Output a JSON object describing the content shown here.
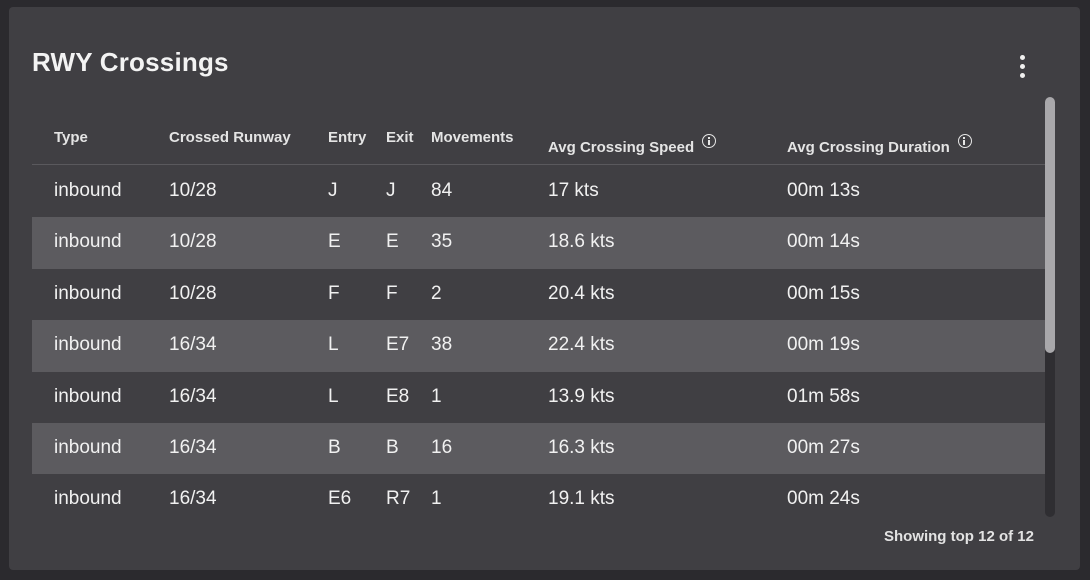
{
  "card": {
    "title": "RWY Crossings",
    "menu_icon": "more-vertical-icon",
    "footer": "Showing top 12 of 12"
  },
  "table": {
    "headers": {
      "type": "Type",
      "runway": "Crossed Runway",
      "entry": "Entry",
      "exit": "Exit",
      "movements": "Movements",
      "speed": "Avg Crossing Speed",
      "duration": "Avg Crossing Duration"
    },
    "info_icon": "info-circle-icon",
    "rows": [
      {
        "type": "inbound",
        "runway": "10/28",
        "entry": "J",
        "exit": "J",
        "movements": "84",
        "speed": "17 kts",
        "duration": "00m 13s"
      },
      {
        "type": "inbound",
        "runway": "10/28",
        "entry": "E",
        "exit": "E",
        "movements": "35",
        "speed": "18.6 kts",
        "duration": "00m 14s"
      },
      {
        "type": "inbound",
        "runway": "10/28",
        "entry": "F",
        "exit": "F",
        "movements": "2",
        "speed": "20.4 kts",
        "duration": "00m 15s"
      },
      {
        "type": "inbound",
        "runway": "16/34",
        "entry": "L",
        "exit": "E7",
        "movements": "38",
        "speed": "22.4 kts",
        "duration": "00m 19s"
      },
      {
        "type": "inbound",
        "runway": "16/34",
        "entry": "L",
        "exit": "E8",
        "movements": "1",
        "speed": "13.9 kts",
        "duration": "01m 58s"
      },
      {
        "type": "inbound",
        "runway": "16/34",
        "entry": "B",
        "exit": "B",
        "movements": "16",
        "speed": "16.3 kts",
        "duration": "00m 27s"
      },
      {
        "type": "inbound",
        "runway": "16/34",
        "entry": "E6",
        "exit": "R7",
        "movements": "1",
        "speed": "19.1 kts",
        "duration": "00m 24s"
      }
    ]
  },
  "colors": {
    "background": "#2b2a2e",
    "card": "#403f43",
    "row_alt": "#5c5b5f",
    "text": "#f1f1f1"
  }
}
